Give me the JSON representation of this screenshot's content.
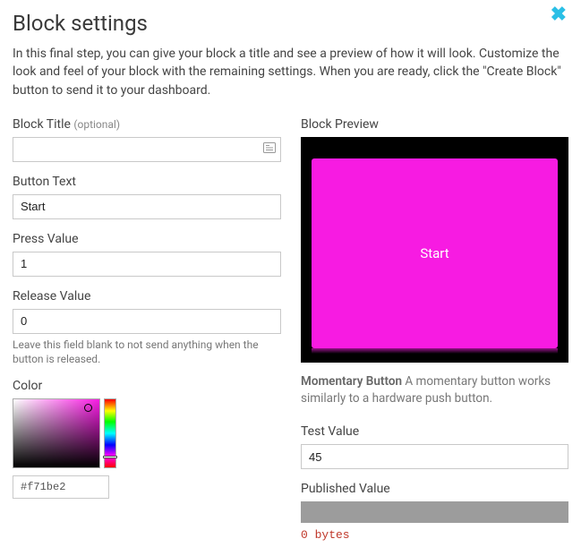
{
  "header": {
    "title": "Block settings",
    "description": "In this final step, you can give your block a title and see a preview of how it will look. Customize the look and feel of your block with the remaining settings. When you are ready, click the \"Create Block\" button to send it to your dashboard."
  },
  "form": {
    "block_title": {
      "label": "Block Title",
      "optional": "(optional)",
      "value": ""
    },
    "button_text": {
      "label": "Button Text",
      "value": "Start"
    },
    "press_value": {
      "label": "Press Value",
      "value": "1"
    },
    "release_value": {
      "label": "Release Value",
      "value": "0",
      "helper": "Leave this field blank to not send anything when the button is released."
    },
    "color": {
      "label": "Color",
      "hex": "#f71be2"
    }
  },
  "preview": {
    "label": "Block Preview",
    "button_text": "Start",
    "type_name": "Momentary Button",
    "type_desc": "A momentary button works similarly to a hardware push button.",
    "test_value": {
      "label": "Test Value",
      "value": "45"
    },
    "published": {
      "label": "Published Value",
      "bytes": "0 bytes"
    }
  }
}
